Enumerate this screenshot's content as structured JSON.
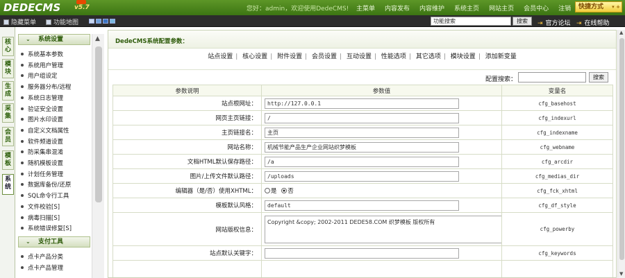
{
  "header": {
    "logo": "DEDECMS",
    "version": "v5.7",
    "welcome": "您好：admin，欢迎使用DedeCMS!",
    "nav": [
      "主菜单",
      "内容发布",
      "内容维护",
      "系统主页",
      "网站主页",
      "会员中心",
      "注销"
    ],
    "quick_label": "快捷方式"
  },
  "toolbar": {
    "hide_menu": "隐藏菜单",
    "function_map": "功能地图",
    "search_value": "功能搜索",
    "search_button": "搜索",
    "forum": "官方论坛",
    "help": "在线帮助"
  },
  "vtabs": [
    "核心",
    "模块",
    "生成",
    "采集",
    "会员",
    "模板",
    "系统"
  ],
  "menu": {
    "section1": "系统设置",
    "items1": [
      "系统基本参数",
      "系统用户管理",
      "用户组设定",
      "服务器分布/远程",
      "系统日志管理",
      "验证安全设置",
      "图片水印设置",
      "自定义文档属性",
      "软件频道设置",
      "防采集串混淆",
      "随机模板设置",
      "计划任务管理",
      "数据库备份/还原",
      "SQL命令行工具",
      "文件校验[S]",
      "病毒扫描[S]",
      "系统错误修复[S]"
    ],
    "section2": "支付工具",
    "items2": [
      "点卡产品分类",
      "点卡产品管理"
    ]
  },
  "main": {
    "title": "DedeCMS系统配置参数：",
    "tabs": [
      "站点设置",
      "核心设置",
      "附件设置",
      "会员设置",
      "互动设置",
      "性能选项",
      "其它选项",
      "模块设置",
      "添加新变量"
    ],
    "config_search_label": "配置搜索：",
    "config_search_button": "搜索",
    "columns": [
      "参数说明",
      "参数值",
      "变量名"
    ],
    "rows": [
      {
        "label": "站点根网址：",
        "value": "http://127.0.0.1",
        "var": "cfg_basehost"
      },
      {
        "label": "网页主页链接：",
        "value": "/",
        "var": "cfg_indexurl"
      },
      {
        "label": "主页链接名：",
        "value": "主页",
        "var": "cfg_indexname"
      },
      {
        "label": "网站名称：",
        "value": "机械节能产品生产企业网站织梦模板",
        "var": "cfg_webname"
      },
      {
        "label": "文档HTML默认保存路径：",
        "value": "/a",
        "var": "cfg_arcdir"
      },
      {
        "label": "图片/上传文件默认路径：",
        "value": "/uploads",
        "var": "cfg_medias_dir"
      },
      {
        "label": "编辑器（是/否）使用XHTML：",
        "radio_yes": "是",
        "radio_no": "否",
        "var": "cfg_fck_xhtml"
      },
      {
        "label": "模板默认风格：",
        "value": "default",
        "var": "cfg_df_style"
      },
      {
        "label": "网站版权信息：",
        "value": "Copyright &copy; 2002-2011 DEDE58.COM 织梦模板 版权所有",
        "var": "cfg_powerby"
      },
      {
        "label": "站点默认关键字：",
        "value": "",
        "var": "cfg_keywords"
      }
    ]
  }
}
